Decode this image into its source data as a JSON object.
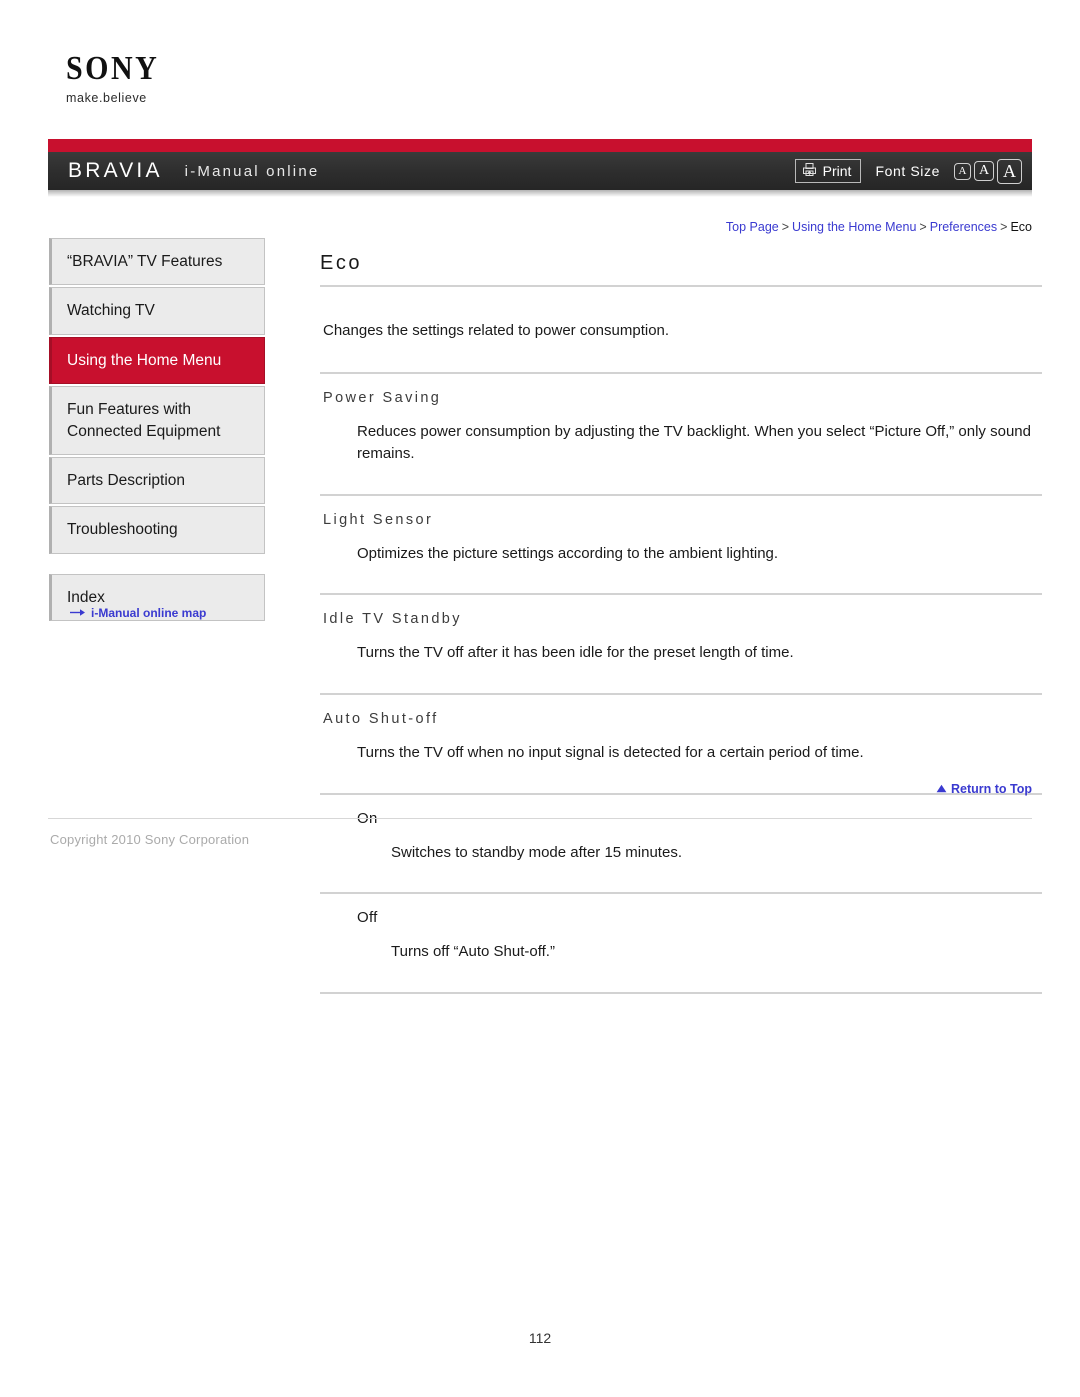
{
  "brand": {
    "logo_text": "SONY",
    "tagline": "make.believe"
  },
  "header": {
    "product_mark": "BRAVIA",
    "title": "i-Manual online",
    "print_label": "Print",
    "font_size_label": "Font Size",
    "font_sizes": [
      "A",
      "A",
      "A"
    ],
    "red_bar_color": "#c8102e",
    "bar_color": "#2d2d2d"
  },
  "breadcrumb": {
    "items": [
      {
        "label": "Top Page",
        "link": true
      },
      {
        "label": "Using the Home Menu",
        "link": true
      },
      {
        "label": "Preferences",
        "link": true
      },
      {
        "label": "Eco",
        "link": false
      }
    ],
    "separator": ">",
    "link_color": "#3a3ad0"
  },
  "sidebar": {
    "items": [
      {
        "label": "“BRAVIA” TV Features",
        "active": false
      },
      {
        "label": "Watching TV",
        "active": false
      },
      {
        "label": "Using the Home Menu",
        "active": true
      },
      {
        "label": "Fun Features with\nConnected Equipment",
        "active": false
      },
      {
        "label": "Parts Description",
        "active": false
      },
      {
        "label": "Troubleshooting",
        "active": false
      }
    ],
    "index_item": {
      "label": "Index"
    },
    "map_link": "i-Manual online map",
    "active_color": "#c8102e",
    "item_bg": "#ebebeb"
  },
  "main": {
    "title": "Eco",
    "intro": "Changes the settings related to power consumption.",
    "sections": [
      {
        "title": "Power Saving",
        "body": "Reduces power consumption by adjusting the TV backlight. When you select “Picture Off,” only sound remains."
      },
      {
        "title": "Light Sensor",
        "body": "Optimizes the picture settings according to the ambient lighting."
      },
      {
        "title": "Idle TV Standby",
        "body": "Turns the TV off after it has been idle for the preset length of time."
      },
      {
        "title": "Auto Shut-off",
        "body": "Turns the TV off when no input signal is detected for a certain period of time."
      }
    ],
    "options": [
      {
        "title": "On",
        "body": "Switches to standby mode after 15 minutes."
      },
      {
        "title": "Off",
        "body": "Turns off “Auto Shut-off.”"
      }
    ]
  },
  "footer": {
    "return_to_top": "Return to Top",
    "copyright": "Copyright 2010 Sony Corporation",
    "page_number": "112"
  }
}
